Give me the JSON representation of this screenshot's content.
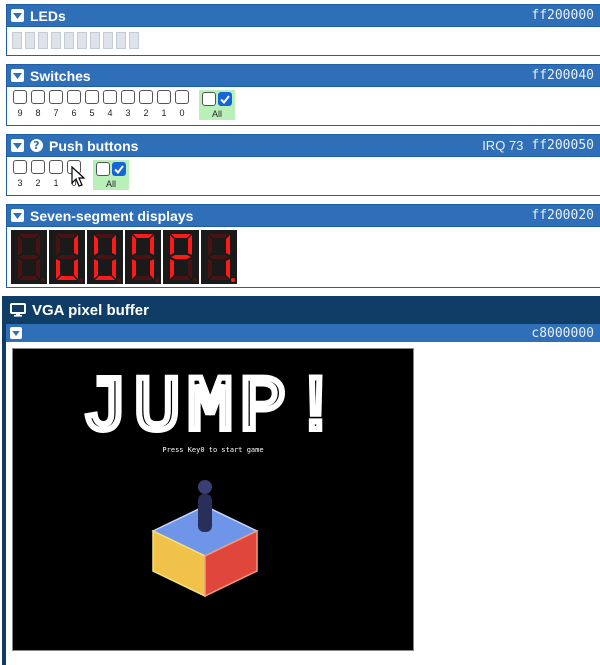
{
  "leds": {
    "title": "LEDs",
    "address": "ff200000",
    "count": 10
  },
  "switches": {
    "title": "Switches",
    "address": "ff200040",
    "labels": [
      "9",
      "8",
      "7",
      "6",
      "5",
      "4",
      "3",
      "2",
      "1",
      "0"
    ],
    "all_label": "All"
  },
  "push_buttons": {
    "title": "Push buttons",
    "irq": "IRQ 73",
    "address": "ff200050",
    "labels": [
      "3",
      "2",
      "1",
      "0"
    ],
    "all_label": "All"
  },
  "seven_segment": {
    "title": "Seven-segment displays",
    "address": "ff200020",
    "digits": [
      "",
      "J",
      "U",
      "M",
      "P",
      "!"
    ]
  },
  "vga": {
    "title": "VGA pixel buffer",
    "address": "c8000000",
    "screen_title": "JUMP!",
    "screen_prompt": "Press Key0 to start game"
  },
  "colors": {
    "header_blue": "#2f6fb8",
    "vga_header": "#0f3d66",
    "checkbox_checked": "#1565d8",
    "all_highlight": "#b9f0b9",
    "segment_on": "#ff1a1a"
  }
}
